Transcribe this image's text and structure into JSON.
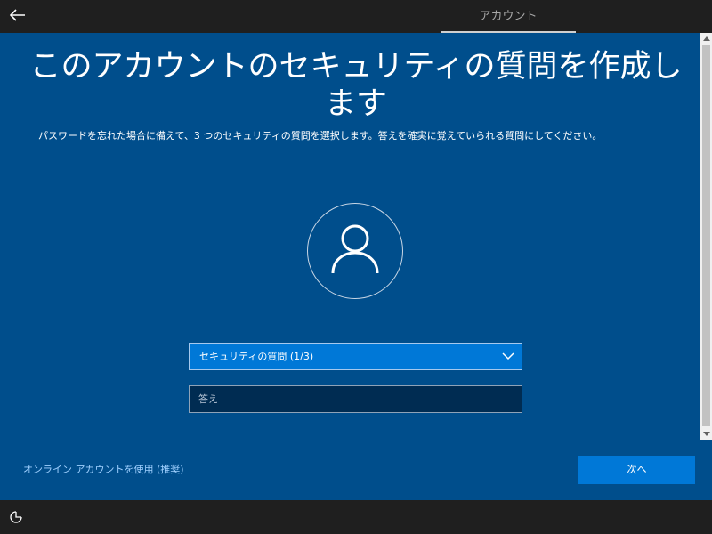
{
  "header": {
    "tab_label": "アカウント"
  },
  "main": {
    "title": "このアカウントのセキュリティの質問を作成します",
    "description": "パスワードを忘れた場合に備えて、3 つのセキュリティの質問を選択します。答えを確実に覚えていられる質問にしてください。",
    "security_question": {
      "selected": "セキュリティの質問 (1/3)"
    },
    "answer": {
      "placeholder": "答え",
      "value": ""
    },
    "online_account_link": "オンライン アカウントを使用 (推奨)",
    "next_button": "次へ"
  },
  "icons": {
    "back": "back-arrow-icon",
    "avatar": "user-icon",
    "dropdown": "chevron-down-icon",
    "accessibility": "ease-of-access-icon"
  },
  "colors": {
    "background": "#004e8c",
    "accent": "#0078d7",
    "link": "#9fd0ff",
    "bar": "#1f1f1f"
  }
}
